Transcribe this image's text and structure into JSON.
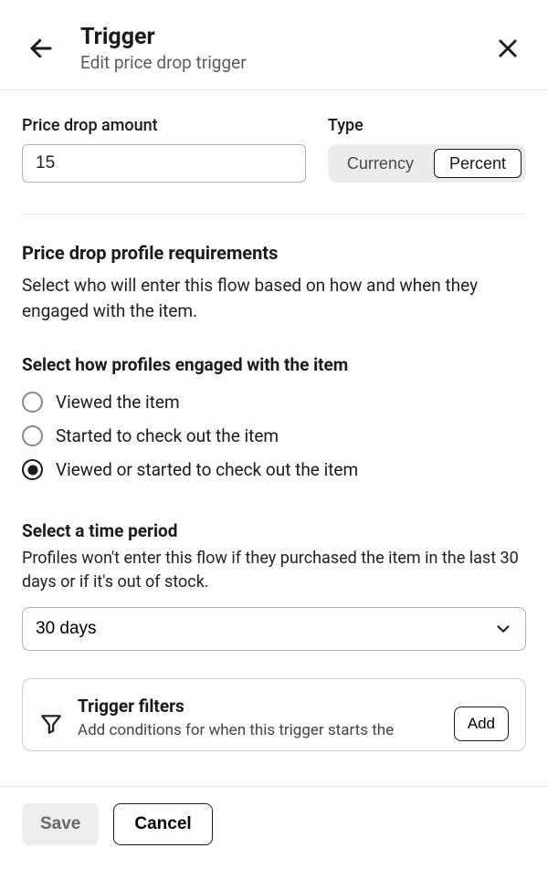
{
  "header": {
    "title": "Trigger",
    "subtitle": "Edit price drop trigger"
  },
  "price_drop": {
    "label": "Price drop amount",
    "value": "15"
  },
  "type": {
    "label": "Type",
    "option_currency": "Currency",
    "option_percent": "Percent",
    "selected": "Percent"
  },
  "requirements": {
    "heading": "Price drop profile requirements",
    "body": "Select who will enter this flow based on how and when they engaged with the item."
  },
  "engagement": {
    "heading": "Select how profiles engaged with the item",
    "options": {
      "viewed": "Viewed the item",
      "started": "Started to check out the item",
      "viewed_or_started": "Viewed or started to check out the item"
    },
    "selected": "viewed_or_started"
  },
  "time_period": {
    "heading": "Select a time period",
    "body": "Profiles won't enter this flow if they purchased the item in the last 30 days or if it's out of stock.",
    "selected_label": "30 days"
  },
  "filters": {
    "title": "Trigger filters",
    "body": "Add conditions for when this trigger starts the",
    "add_label": "Add"
  },
  "footer": {
    "save_label": "Save",
    "cancel_label": "Cancel"
  }
}
